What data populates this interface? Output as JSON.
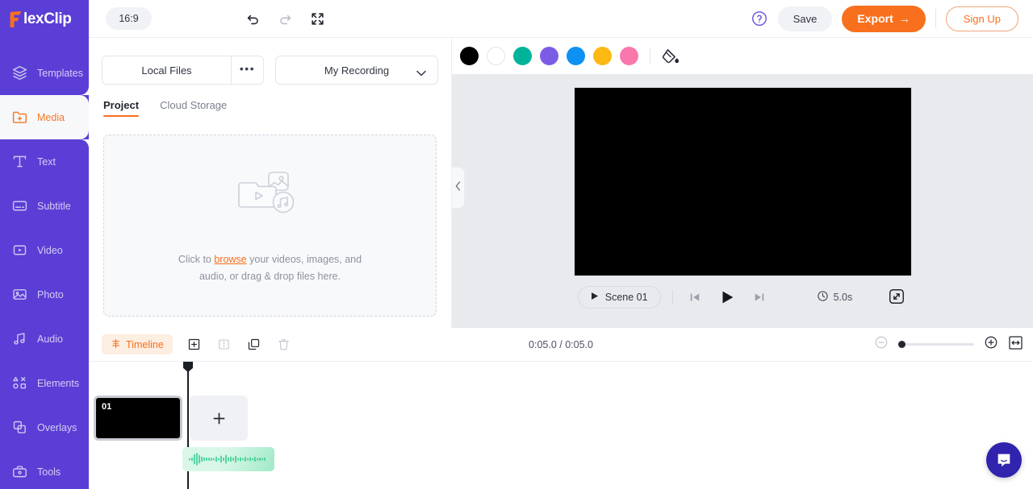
{
  "brand": {
    "logo_text": "lexClip",
    "logo_mark": "F",
    "sidebar_color": "#5b3ed6",
    "accent_color": "#f8701e"
  },
  "sidebar": {
    "items": [
      {
        "label": "Templates",
        "icon": "layers-icon",
        "active": false
      },
      {
        "label": "Media",
        "icon": "media-folder-icon",
        "active": true
      },
      {
        "label": "Text",
        "icon": "text-icon",
        "active": false
      },
      {
        "label": "Subtitle",
        "icon": "subtitle-icon",
        "active": false
      },
      {
        "label": "Video",
        "icon": "video-icon",
        "active": false
      },
      {
        "label": "Photo",
        "icon": "photo-icon",
        "active": false
      },
      {
        "label": "Audio",
        "icon": "audio-note-icon",
        "active": false
      },
      {
        "label": "Elements",
        "icon": "elements-shapes-icon",
        "active": false
      },
      {
        "label": "Overlays",
        "icon": "overlays-icon",
        "active": false
      },
      {
        "label": "Tools",
        "icon": "toolbox-icon",
        "active": false
      }
    ]
  },
  "header": {
    "aspect_ratio": "16:9",
    "undo_icon": "undo-icon",
    "redo_icon": "redo-icon",
    "fullscreen_icon": "fullscreen-icon",
    "help_icon": "help-circle-icon",
    "save_label": "Save",
    "export_label": "Export",
    "export_arrow": "→",
    "signup_label": "Sign Up"
  },
  "media_panel": {
    "local_files_label": "Local Files",
    "more_label": "•••",
    "recording_label": "My Recording",
    "tabs": [
      {
        "label": "Project",
        "active": true
      },
      {
        "label": "Cloud Storage",
        "active": false
      }
    ],
    "dropzone": {
      "icon": "media-upload-icon",
      "prefix": "Click to ",
      "link": "browse",
      "suffix": " your videos, images, and",
      "line2": "audio, or drag & drop files here."
    },
    "collapse_icon": "chevron-left-icon"
  },
  "preview": {
    "swatches": [
      {
        "name": "black",
        "hex": "#000000"
      },
      {
        "name": "white",
        "hex": "#ffffff"
      },
      {
        "name": "teal",
        "hex": "#00b39a"
      },
      {
        "name": "purple",
        "hex": "#7c5ce6"
      },
      {
        "name": "blue",
        "hex": "#0d92f4"
      },
      {
        "name": "yellow",
        "hex": "#fcb813"
      },
      {
        "name": "pink",
        "hex": "#fa77ad"
      }
    ],
    "bucket_icon": "paint-bucket-icon",
    "scene_label": "Scene 01",
    "prev_icon": "skip-previous-icon",
    "play_icon": "play-icon",
    "next_icon": "skip-next-icon",
    "duration": "5.0s",
    "clock_icon": "clock-icon",
    "expand_icon": "expand-icon",
    "canvas_color": "#000000"
  },
  "timeline": {
    "badge_label": "Timeline",
    "badge_icon": "timeline-icon",
    "tools": [
      {
        "name": "add-icon",
        "enabled": true
      },
      {
        "name": "split-icon",
        "enabled": false
      },
      {
        "name": "duplicate-icon",
        "enabled": true
      },
      {
        "name": "delete-icon",
        "enabled": false
      }
    ],
    "time_display": "0:05.0 / 0:05.0",
    "zoom_out_icon": "zoom-out-icon",
    "zoom_in_icon": "zoom-in-icon",
    "fit_icon": "fit-to-screen-icon",
    "zoom_value": 0,
    "scenes": [
      {
        "number": "01",
        "selected": true
      }
    ],
    "add_scene_label": "+",
    "audio_track": {
      "name": "audio-clip",
      "color": "#d9f7e8"
    }
  },
  "support": {
    "chat_icon": "intercom-chat-icon"
  }
}
